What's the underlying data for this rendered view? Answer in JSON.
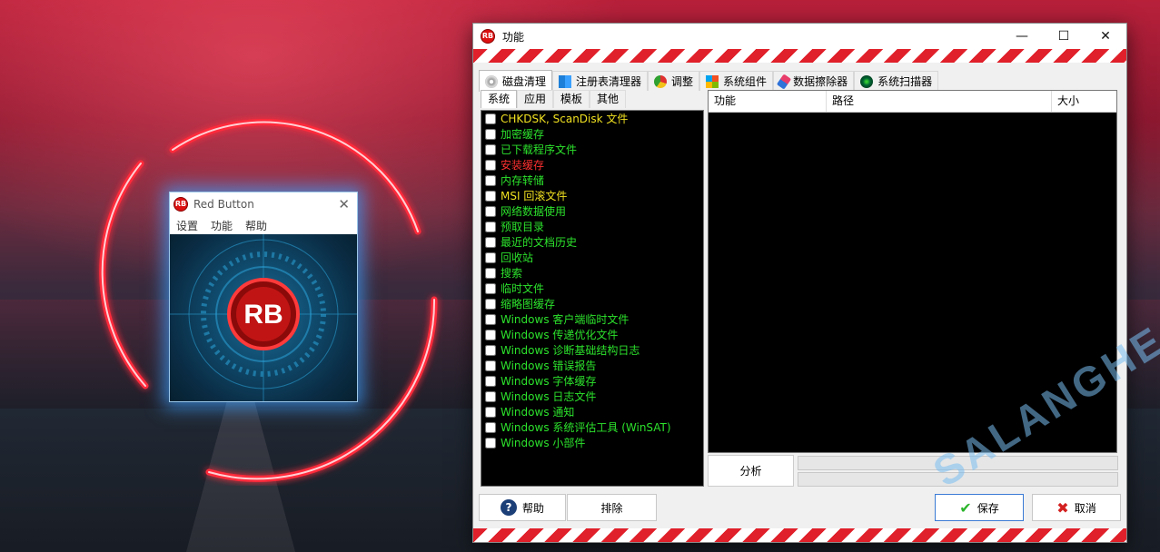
{
  "mini_window": {
    "title": "Red Button",
    "menu": [
      "设置",
      "功能",
      "帮助"
    ],
    "logo_text": "RB"
  },
  "main_window": {
    "title": "功能",
    "logo_text": "RB",
    "controls": {
      "minimize": "—",
      "maximize": "☐",
      "close": "✕"
    }
  },
  "tabs": [
    {
      "label": "磁盘清理",
      "icon": "disk-icon"
    },
    {
      "label": "注册表清理器",
      "icon": "registry-icon"
    },
    {
      "label": "调整",
      "icon": "tweak-icon"
    },
    {
      "label": "系统组件",
      "icon": "windows-icon"
    },
    {
      "label": "数据擦除器",
      "icon": "eraser-icon"
    },
    {
      "label": "系统扫描器",
      "icon": "scanner-icon"
    }
  ],
  "subtabs": [
    "系统",
    "应用",
    "模板",
    "其他"
  ],
  "items": [
    {
      "label": "CHKDSK, ScanDisk 文件",
      "color": "yellow"
    },
    {
      "label": "加密缓存",
      "color": "green"
    },
    {
      "label": "已下载程序文件",
      "color": "green"
    },
    {
      "label": "安装缓存",
      "color": "red"
    },
    {
      "label": "内存转储",
      "color": "green"
    },
    {
      "label": "MSI 回滚文件",
      "color": "yellow"
    },
    {
      "label": "网络数据使用",
      "color": "green"
    },
    {
      "label": "预取目录",
      "color": "green"
    },
    {
      "label": "最近的文档历史",
      "color": "green"
    },
    {
      "label": "回收站",
      "color": "green"
    },
    {
      "label": "搜索",
      "color": "green"
    },
    {
      "label": "临时文件",
      "color": "green"
    },
    {
      "label": "缩略图缓存",
      "color": "green"
    },
    {
      "label": "Windows 客户端临时文件",
      "color": "green"
    },
    {
      "label": "Windows 传递优化文件",
      "color": "green"
    },
    {
      "label": "Windows 诊断基础结构日志",
      "color": "green"
    },
    {
      "label": "Windows 错误报告",
      "color": "green"
    },
    {
      "label": "Windows 字体缓存",
      "color": "green"
    },
    {
      "label": "Windows 日志文件",
      "color": "green"
    },
    {
      "label": "Windows 通知",
      "color": "green"
    },
    {
      "label": "Windows 系统评估工具 (WinSAT)",
      "color": "green"
    },
    {
      "label": "Windows 小部件",
      "color": "green"
    }
  ],
  "table": {
    "headers": [
      "功能",
      "路径",
      "大小"
    ]
  },
  "analyze_label": "分析",
  "buttons": {
    "help": "帮助",
    "exclude": "排除",
    "save": "保存",
    "cancel": "取消"
  },
  "watermark": "SALANGHE",
  "colors": {
    "yellow": "#f0e020",
    "green": "#2ce22c",
    "red": "#ff3030",
    "accent": "#e0202a"
  }
}
